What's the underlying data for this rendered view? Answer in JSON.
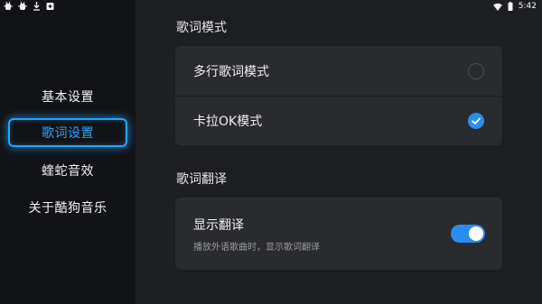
{
  "status_bar": {
    "time": "5:42",
    "left_icons": [
      "bug-icon",
      "bug-icon",
      "download-icon",
      "plus-square-icon"
    ],
    "right_icons": [
      "wifi-icon",
      "battery-icon"
    ]
  },
  "sidebar": {
    "items": [
      {
        "label": "基本设置",
        "active": false
      },
      {
        "label": "歌词设置",
        "active": true
      },
      {
        "label": "蝰蛇音效",
        "active": false
      },
      {
        "label": "关于酷狗音乐",
        "active": false
      }
    ]
  },
  "lyrics_mode": {
    "title": "歌词模式",
    "options": [
      {
        "label": "多行歌词模式",
        "checked": false
      },
      {
        "label": "卡拉OK模式",
        "checked": true
      }
    ]
  },
  "lyrics_translation": {
    "title": "歌词翻译",
    "toggle_label": "显示翻译",
    "toggle_description": "播放外语歌曲时，显示歌词翻译",
    "enabled": true
  },
  "colors": {
    "accent": "#2a8df0",
    "active_nav": "#22a7ff"
  }
}
